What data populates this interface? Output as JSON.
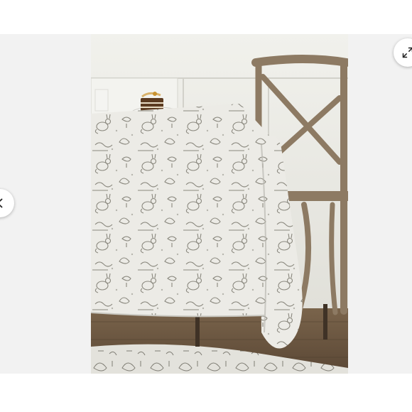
{
  "viewer": {
    "photo": {
      "subject": "toile-tablecloth-on-table",
      "colors": {
        "wall": "#e9e8e2",
        "floor": "#6e5a44",
        "cloth": "#ecebe6",
        "pattern": "#8a887e",
        "chair": "#8d7a63"
      }
    },
    "controls": {
      "prev_icon": "chevron-left-icon",
      "expand_icon": "expand-icon"
    }
  }
}
